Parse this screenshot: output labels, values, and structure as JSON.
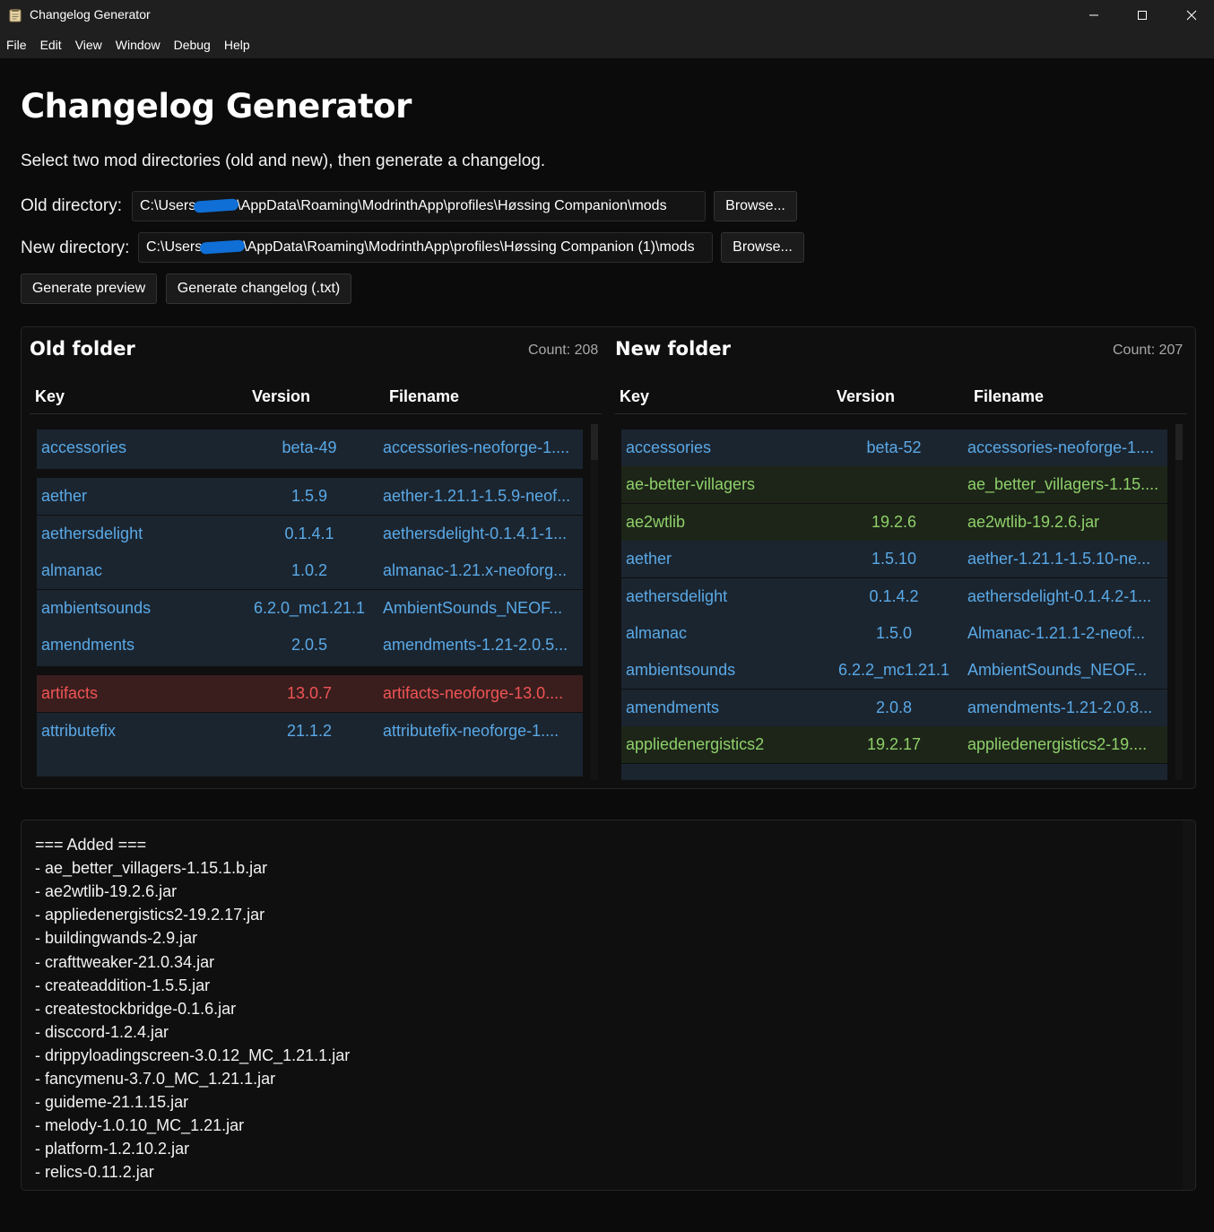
{
  "window": {
    "title": "Changelog Generator",
    "icons": {
      "app": "notepad-icon",
      "minimize": "minimize-icon",
      "maximize": "maximize-icon",
      "close": "close-icon"
    }
  },
  "menu": [
    "File",
    "Edit",
    "View",
    "Window",
    "Debug",
    "Help"
  ],
  "main": {
    "title": "Changelog Generator",
    "subtitle": "Select two mod directories (old and new), then generate a changelog.",
    "old_dir": {
      "label": "Old directory:",
      "value_before": "C:\\Users",
      "value_after": "\\AppData\\Roaming\\ModrinthApp\\profiles\\Høssing Companion\\mods",
      "browse": "Browse..."
    },
    "new_dir": {
      "label": "New directory:",
      "value_before": "C:\\Users",
      "value_after": "\\AppData\\Roaming\\ModrinthApp\\profiles\\Høssing Companion (1)\\mods",
      "browse": "Browse..."
    },
    "generate_preview": "Generate preview",
    "generate_changelog": "Generate changelog (.txt)"
  },
  "colors": {
    "normal": "#5aa9e6",
    "added": "#8ed06a",
    "removed": "#f05454"
  },
  "old_folder": {
    "title": "Old folder",
    "count": "Count: 208",
    "headers": {
      "key": "Key",
      "version": "Version",
      "filename": "Filename"
    },
    "rows": [
      {
        "key": "accessories",
        "version": "beta-49",
        "filename": "accessories-neoforge-1....",
        "status": "normal"
      },
      {
        "key": "",
        "version": "",
        "filename": "",
        "status": "spacer"
      },
      {
        "key": "aether",
        "version": "1.5.9",
        "filename": "aether-1.21.1-1.5.9-neof...",
        "status": "normal"
      },
      {
        "key": "aethersdelight",
        "version": "0.1.4.1",
        "filename": "aethersdelight-0.1.4.1-1...",
        "status": "normal"
      },
      {
        "key": "almanac",
        "version": "1.0.2",
        "filename": "almanac-1.21.x-neoforg...",
        "status": "normal"
      },
      {
        "key": "ambientsounds",
        "version": "6.2.0_mc1.21.1",
        "filename": "AmbientSounds_NEOF...",
        "status": "normal"
      },
      {
        "key": "amendments",
        "version": "2.0.5",
        "filename": "amendments-1.21-2.0.5...",
        "status": "normal"
      },
      {
        "key": "",
        "version": "",
        "filename": "",
        "status": "spacer"
      },
      {
        "key": "artifacts",
        "version": "13.0.7",
        "filename": "artifacts-neoforge-13.0....",
        "status": "removed"
      },
      {
        "key": "attributefix",
        "version": "21.1.2",
        "filename": "attributefix-neoforge-1....",
        "status": "normal"
      }
    ]
  },
  "new_folder": {
    "title": "New folder",
    "count": "Count: 207",
    "headers": {
      "key": "Key",
      "version": "Version",
      "filename": "Filename"
    },
    "rows": [
      {
        "key": "accessories",
        "version": "beta-52",
        "filename": "accessories-neoforge-1....",
        "status": "normal"
      },
      {
        "key": "ae-better-villagers",
        "version": "",
        "filename": "ae_better_villagers-1.15....",
        "status": "added"
      },
      {
        "key": "ae2wtlib",
        "version": "19.2.6",
        "filename": "ae2wtlib-19.2.6.jar",
        "status": "added"
      },
      {
        "key": "aether",
        "version": "1.5.10",
        "filename": "aether-1.21.1-1.5.10-ne...",
        "status": "normal"
      },
      {
        "key": "aethersdelight",
        "version": "0.1.4.2",
        "filename": "aethersdelight-0.1.4.2-1...",
        "status": "normal"
      },
      {
        "key": "almanac",
        "version": "1.5.0",
        "filename": "Almanac-1.21.1-2-neof...",
        "status": "normal"
      },
      {
        "key": "ambientsounds",
        "version": "6.2.2_mc1.21.1",
        "filename": "AmbientSounds_NEOF...",
        "status": "normal"
      },
      {
        "key": "amendments",
        "version": "2.0.8",
        "filename": "amendments-1.21-2.0.8...",
        "status": "normal"
      },
      {
        "key": "appliedenergistics2",
        "version": "19.2.17",
        "filename": "appliedenergistics2-19....",
        "status": "added"
      }
    ]
  },
  "changelog": [
    "=== Added ===",
    "- ae_better_villagers-1.15.1.b.jar",
    "- ae2wtlib-19.2.6.jar",
    "- appliedenergistics2-19.2.17.jar",
    "- buildingwands-2.9.jar",
    "- crafttweaker-21.0.34.jar",
    "- createaddition-1.5.5.jar",
    "- createstockbridge-0.1.6.jar",
    "- disccord-1.2.4.jar",
    "- drippyloadingscreen-3.0.12_MC_1.21.1.jar",
    "- fancymenu-3.7.0_MC_1.21.1.jar",
    "- guideme-21.1.15.jar",
    "- melody-1.0.10_MC_1.21.jar",
    "- platform-1.2.10.2.jar",
    "- relics-0.11.2.jar"
  ]
}
